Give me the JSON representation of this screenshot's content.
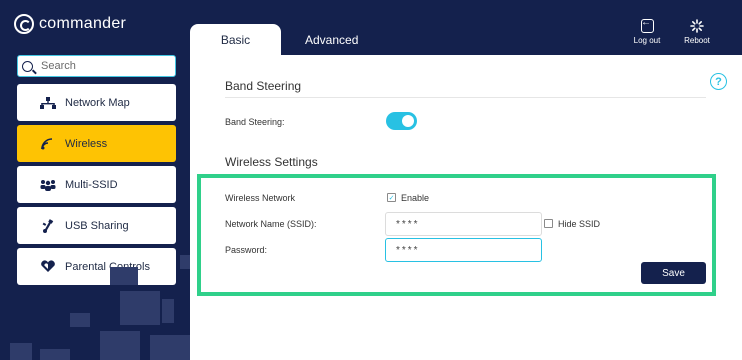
{
  "app": {
    "brand": "commander"
  },
  "tabs": [
    {
      "label": "Basic",
      "active": true
    },
    {
      "label": "Advanced",
      "active": false
    }
  ],
  "top_actions": {
    "logout_label": "Log out",
    "reboot_label": "Reboot"
  },
  "search": {
    "placeholder": "Search",
    "value": ""
  },
  "sidebar": {
    "items": [
      {
        "label": "Network Map",
        "icon": "network-map-icon",
        "active": false
      },
      {
        "label": "Wireless",
        "icon": "wifi-icon",
        "active": true
      },
      {
        "label": "Multi-SSID",
        "icon": "multi-ssid-icon",
        "active": false
      },
      {
        "label": "USB Sharing",
        "icon": "usb-icon",
        "active": false
      },
      {
        "label": "Parental Controls",
        "icon": "heart-shield-icon",
        "active": false
      }
    ]
  },
  "band_steering": {
    "section_title": "Band Steering",
    "label": "Band Steering:",
    "enabled": true
  },
  "wireless_settings": {
    "section_title": "Wireless Settings",
    "wireless_network_label": "Wireless Network",
    "enable_label": "Enable",
    "enable_checked": true,
    "ssid_label": "Network Name (SSID):",
    "ssid_value": "****",
    "hide_ssid_label": "Hide SSID",
    "hide_ssid_checked": false,
    "password_label": "Password:",
    "password_value": "****"
  },
  "actions": {
    "save_label": "Save"
  },
  "colors": {
    "navy": "#14214d",
    "accent_yellow": "#fec303",
    "accent_cyan": "#28c1e3",
    "highlight_green": "#2fd08a"
  }
}
